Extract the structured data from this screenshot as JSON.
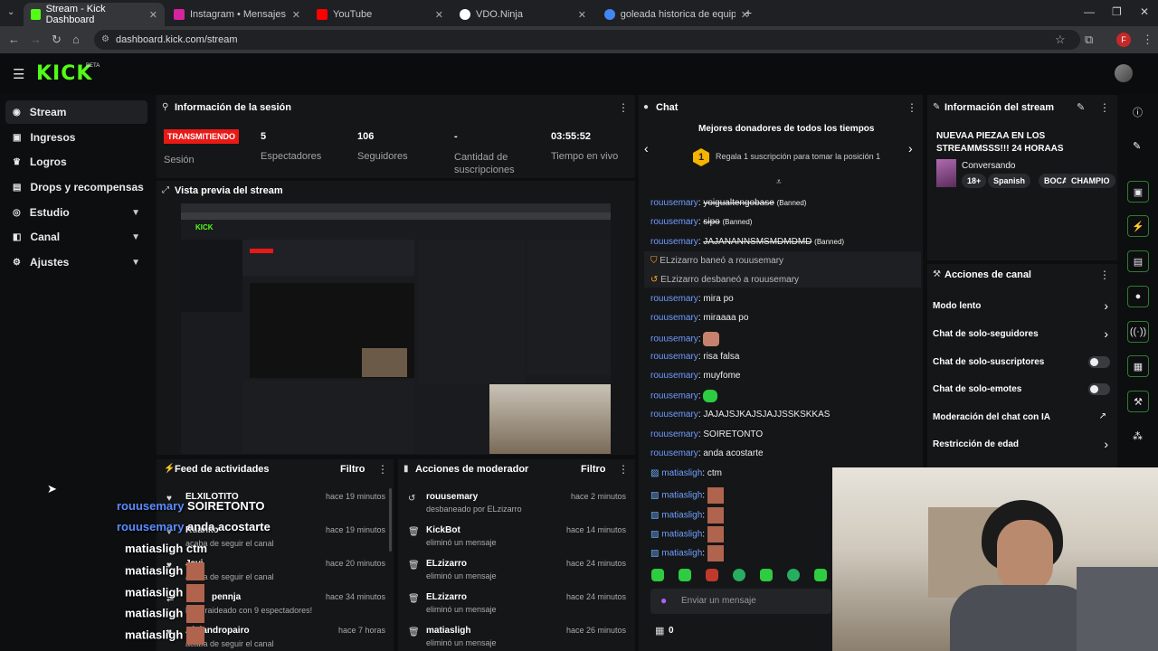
{
  "browser": {
    "tabs": [
      {
        "label": "Stream - Kick Dashboard",
        "favicon_color": "#53fc18"
      },
      {
        "label": "Instagram • Mensajes",
        "favicon_color": "#d6249f"
      },
      {
        "label": "YouTube",
        "favicon_color": "#ff0000"
      },
      {
        "label": "VDO.Ninja",
        "favicon_color": "#ffffff"
      },
      {
        "label": "goleada historica de equipos e",
        "favicon_color": "#4285f4"
      }
    ],
    "url": "dashboard.kick.com/stream",
    "profile_initial": "F"
  },
  "header": {
    "logo": "KICK",
    "badge": "BETA"
  },
  "sidebar": {
    "items": [
      {
        "label": "Stream",
        "icon": "dot-icon"
      },
      {
        "label": "Ingresos",
        "icon": "wallet-icon"
      },
      {
        "label": "Logros",
        "icon": "trophy-icon"
      },
      {
        "label": "Drops y recompensas",
        "icon": "gift-icon"
      },
      {
        "label": "Estudio",
        "icon": "studio-icon"
      },
      {
        "label": "Canal",
        "icon": "channel-icon"
      },
      {
        "label": "Ajustes",
        "icon": "gear-icon"
      }
    ]
  },
  "session": {
    "title": "Información de la sesión",
    "status": "TRANSMITIENDO",
    "status_label": "Sesión",
    "stats": [
      {
        "value": "5",
        "label": "Espectadores"
      },
      {
        "value": "106",
        "label": "Seguidores"
      },
      {
        "value": "-",
        "label": "Cantidad de suscripciones"
      },
      {
        "value": "03:55:52",
        "label": "Tiempo en vivo"
      }
    ]
  },
  "preview": {
    "title": "Vista previa del stream"
  },
  "chat": {
    "title": "Chat",
    "donors_title": "Mejores donadores de todos los tiempos",
    "donor_rank": "1",
    "donor_text": "Regala 1 suscripción para tomar la posición 1",
    "messages": [
      {
        "user": "rouusemary",
        "text": "yoigualtengobase",
        "suffix": "(Banned)"
      },
      {
        "user": "rouusemary",
        "text": "sipo",
        "suffix": "(Banned)"
      },
      {
        "user": "rouusemary",
        "text": "JAJANANNSMSMDMDMD",
        "suffix": "(Banned)"
      },
      {
        "user": "ELzizarro",
        "text": "baneó a rouusemary",
        "suffix": ""
      },
      {
        "user": "ELzizarro",
        "text": "desbaneó a rouusemary",
        "suffix": ""
      },
      {
        "user": "rouusemary",
        "text": "mira po",
        "suffix": ""
      },
      {
        "user": "rouusemary",
        "text": "miraaaa po",
        "suffix": ""
      },
      {
        "user": "rouusemary",
        "text": "",
        "suffix": ""
      },
      {
        "user": "rouusemary",
        "text": "risa falsa",
        "suffix": ""
      },
      {
        "user": "rouusemary",
        "text": "muyfome",
        "suffix": ""
      },
      {
        "user": "rouusemary",
        "text": "",
        "suffix": ""
      },
      {
        "user": "rouusemary",
        "text": "JAJAJSJKAJSJAJJSSKSKKAS",
        "suffix": ""
      },
      {
        "user": "rouusemary",
        "text": "SOIRETONTO",
        "suffix": ""
      },
      {
        "user": "rouusemary",
        "text": "anda acostarte",
        "suffix": ""
      },
      {
        "user": "matiasligh",
        "text": "ctm",
        "suffix": ""
      },
      {
        "user": "matiasligh",
        "text": "",
        "suffix": ""
      },
      {
        "user": "matiasligh",
        "text": "",
        "suffix": ""
      },
      {
        "user": "matiasligh",
        "text": "",
        "suffix": ""
      },
      {
        "user": "matiasligh",
        "text": "",
        "suffix": ""
      }
    ],
    "input_placeholder": "Enviar un mensaje",
    "points": "0"
  },
  "stream_info": {
    "title": "Información del stream",
    "stream_title": "NUEVAA PIEZAA EN LOS STREAMMSSS!!! 24 HORAAS",
    "category": "Conversando",
    "tags": [
      "18+",
      "Spanish",
      "BOCA",
      "CHAMPIO"
    ]
  },
  "channel_actions": {
    "title": "Acciones de canal",
    "items": [
      {
        "label": "Modo lento",
        "control": "chevron"
      },
      {
        "label": "Chat de solo-seguidores",
        "control": "chevron"
      },
      {
        "label": "Chat de solo-suscriptores",
        "control": "toggle"
      },
      {
        "label": "Chat de solo-emotes",
        "control": "toggle"
      },
      {
        "label": "Moderación del chat con IA",
        "control": "external"
      },
      {
        "label": "Restricción de edad",
        "control": "chevron"
      }
    ]
  },
  "activity": {
    "title": "Feed de actividades",
    "filter": "Filtro",
    "items": [
      {
        "user": "ELXILOTITO",
        "text": "",
        "time": "hace 19 minutos"
      },
      {
        "user": "Ruanko",
        "text": "",
        "time": "hace 19 minutos"
      },
      {
        "user": "",
        "text": "acaba de seguir el canal",
        "time": "hace 20 minutos"
      },
      {
        "user": "Javi",
        "text": "acaba de seguir el canal",
        "time": "hace 20 minutos"
      },
      {
        "user": "pennja",
        "text": "llegó raideado con 9 espectadores!",
        "time": "hace 34 minutos"
      },
      {
        "user": "Alejandropairo",
        "text": "acaba de seguir el canal",
        "time": "hace 7 horas"
      }
    ]
  },
  "mod_actions": {
    "title": "Acciones de moderador",
    "filter": "Filtro",
    "items": [
      {
        "user": "rouusemary",
        "text": "desbaneado por ELzizarro",
        "time": "hace 2 minutos"
      },
      {
        "user": "KickBot",
        "text": "eliminó un mensaje",
        "time": "hace 14 minutos"
      },
      {
        "user": "ELzizarro",
        "text": "eliminó un mensaje",
        "time": "hace 24 minutos"
      },
      {
        "user": "ELzizarro",
        "text": "eliminó un mensaje",
        "time": "hace 24 minutos"
      },
      {
        "user": "matiasligh",
        "text": "eliminó un mensaje",
        "time": "hace 26 minutos"
      }
    ]
  },
  "overlay_chat": [
    {
      "user": "rouusemary",
      "text": "SOIRETONTO"
    },
    {
      "user": "rouusemary",
      "text": "anda acostarte"
    },
    {
      "user": "matiasligh",
      "text": "ctm"
    },
    {
      "user": "matiasligh",
      "text": ""
    },
    {
      "user": "matiasligh",
      "text": ""
    },
    {
      "user": "matiasligh",
      "text": ""
    },
    {
      "user": "matiasligh",
      "text": ""
    }
  ],
  "colors": {
    "accent": "#53fc18",
    "live": "#e91916",
    "user": "#6f9cff"
  }
}
